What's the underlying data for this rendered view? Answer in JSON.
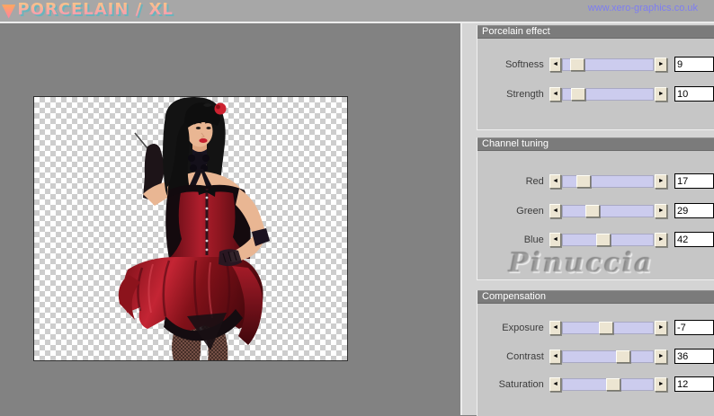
{
  "header": {
    "logo_text": "PORCELAIN / XL",
    "url": "www.xero-graphics.co.uk"
  },
  "icons": {
    "logo_triangle": "▼",
    "left_arrow": "◄",
    "right_arrow": "►"
  },
  "watermark": "Pinuccia",
  "sections": [
    {
      "title": "Porcelain effect",
      "sliders": [
        {
          "label": "Softness",
          "value": 9,
          "thumb_pct": 0.09
        },
        {
          "label": "Strength",
          "value": 10,
          "thumb_pct": 0.1
        }
      ]
    },
    {
      "title": "Channel tuning",
      "sliders": [
        {
          "label": "Red",
          "value": 17,
          "thumb_pct": 0.17
        },
        {
          "label": "Green",
          "value": 29,
          "thumb_pct": 0.29
        },
        {
          "label": "Blue",
          "value": 42,
          "thumb_pct": 0.42
        }
      ]
    },
    {
      "title": "Compensation",
      "sliders": [
        {
          "label": "Exposure",
          "value": -7,
          "thumb_pct": 0.465
        },
        {
          "label": "Contrast",
          "value": 36,
          "thumb_pct": 0.68
        },
        {
          "label": "Saturation",
          "value": 12,
          "thumb_pct": 0.555
        }
      ]
    }
  ],
  "colors": {
    "topbar_bg": "#a7a7a7",
    "preview_bg": "#828282",
    "panel_bg": "#d4d4d4",
    "group_bg": "#c6c6c6",
    "group_header_bg": "#7b7b7b",
    "slider_track": "#ccccee",
    "control_cream": "#ece5d2",
    "link": "#7d7df2",
    "logo_gradient_top": "#f9cc80",
    "logo_gradient_bottom": "#f590bd",
    "logo_shadow": "#6ab4bc"
  }
}
